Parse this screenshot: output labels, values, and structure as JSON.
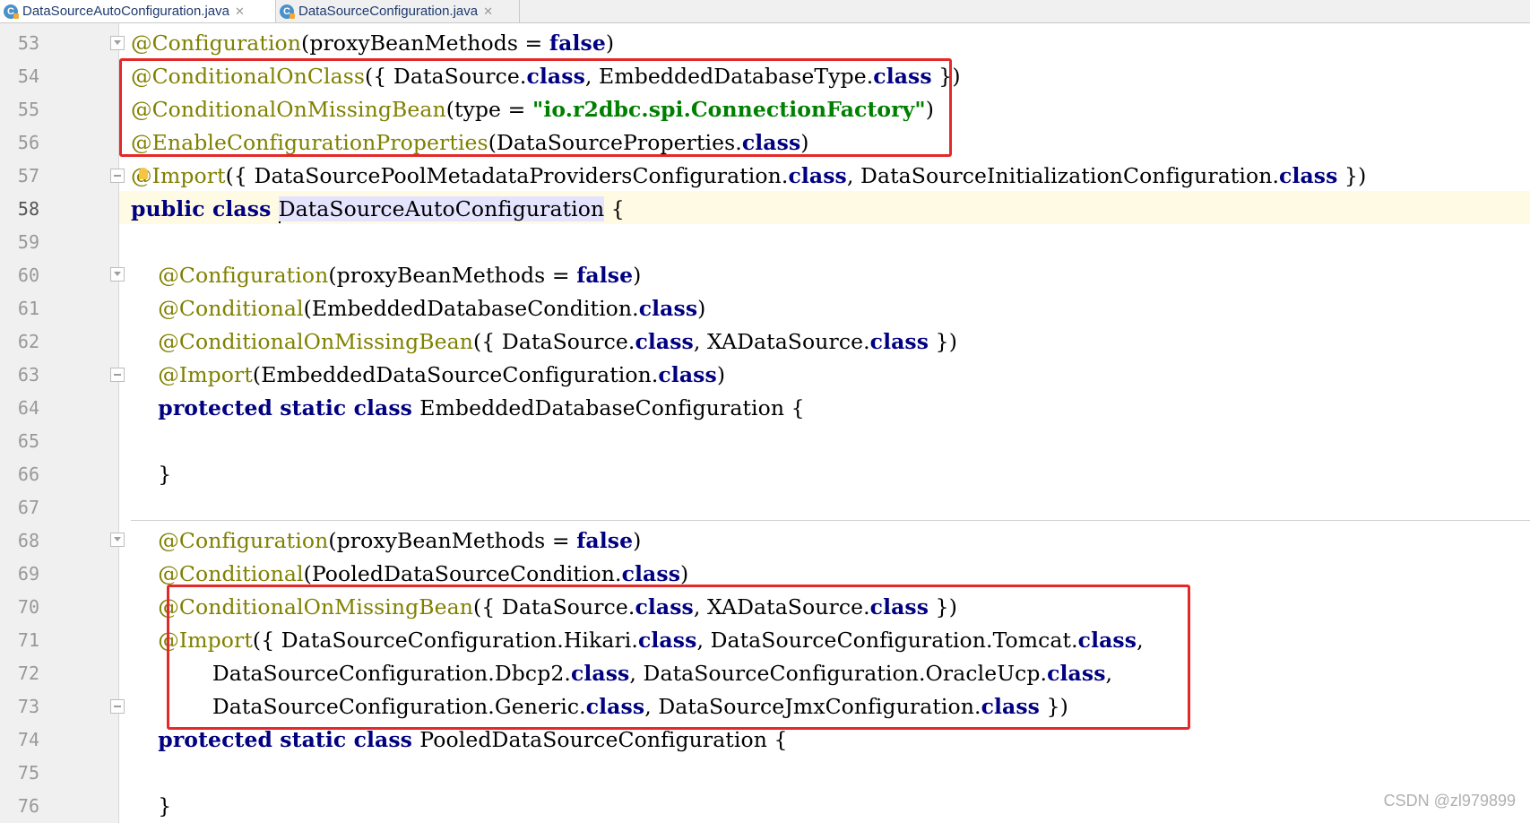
{
  "tabs": [
    {
      "label": "DataSourceAutoConfiguration.java",
      "icon": "java-class-icon",
      "active": true
    },
    {
      "label": "DataSourceConfiguration.java",
      "icon": "java-class-icon",
      "active": false
    }
  ],
  "editor": {
    "caret_line": "58",
    "lines": [
      {
        "num": "53",
        "parts": [
          [
            "ann",
            "@Configuration"
          ],
          [
            "pl",
            "(proxyBeanMethods = "
          ],
          [
            "kw",
            "false"
          ],
          [
            "pl",
            ")"
          ]
        ]
      },
      {
        "num": "54",
        "parts": [
          [
            "ann",
            "@ConditionalOnClass"
          ],
          [
            "pl",
            "({ DataSource."
          ],
          [
            "kw",
            "class"
          ],
          [
            "pl",
            ", EmbeddedDatabaseType."
          ],
          [
            "kw",
            "class"
          ],
          [
            "pl",
            " })"
          ]
        ]
      },
      {
        "num": "55",
        "parts": [
          [
            "ann",
            "@ConditionalOnMissingBean"
          ],
          [
            "pl",
            "(type = "
          ],
          [
            "str",
            "\"io.r2dbc.spi.ConnectionFactory\""
          ],
          [
            "pl",
            ")"
          ]
        ]
      },
      {
        "num": "56",
        "parts": [
          [
            "ann",
            "@EnableConfigurationProperties"
          ],
          [
            "pl",
            "(DataSourceProperties."
          ],
          [
            "kw",
            "class"
          ],
          [
            "pl",
            ")"
          ]
        ]
      },
      {
        "num": "57",
        "parts": [
          [
            "ann",
            "@Import"
          ],
          [
            "pl",
            "({ DataSourcePoolMetadataProvidersConfiguration."
          ],
          [
            "kw",
            "class"
          ],
          [
            "pl",
            ", DataSourceInitializationConfiguration."
          ],
          [
            "kw",
            "class"
          ],
          [
            "pl",
            " })"
          ]
        ]
      },
      {
        "num": "58",
        "parts": [
          [
            "kw",
            "public class "
          ],
          [
            "hl",
            "DataSourceAutoConfiguration"
          ],
          [
            "pl",
            " {"
          ]
        ]
      },
      {
        "num": "59",
        "parts": []
      },
      {
        "num": "60",
        "parts": [
          [
            "pl",
            "    "
          ],
          [
            "ann",
            "@Configuration"
          ],
          [
            "pl",
            "(proxyBeanMethods = "
          ],
          [
            "kw",
            "false"
          ],
          [
            "pl",
            ")"
          ]
        ]
      },
      {
        "num": "61",
        "parts": [
          [
            "pl",
            "    "
          ],
          [
            "ann",
            "@Conditional"
          ],
          [
            "pl",
            "(EmbeddedDatabaseCondition."
          ],
          [
            "kw",
            "class"
          ],
          [
            "pl",
            ")"
          ]
        ]
      },
      {
        "num": "62",
        "parts": [
          [
            "pl",
            "    "
          ],
          [
            "ann",
            "@ConditionalOnMissingBean"
          ],
          [
            "pl",
            "({ DataSource."
          ],
          [
            "kw",
            "class"
          ],
          [
            "pl",
            ", XADataSource."
          ],
          [
            "kw",
            "class"
          ],
          [
            "pl",
            " })"
          ]
        ]
      },
      {
        "num": "63",
        "parts": [
          [
            "pl",
            "    "
          ],
          [
            "ann",
            "@Import"
          ],
          [
            "pl",
            "(EmbeddedDataSourceConfiguration."
          ],
          [
            "kw",
            "class"
          ],
          [
            "pl",
            ")"
          ]
        ]
      },
      {
        "num": "64",
        "parts": [
          [
            "pl",
            "    "
          ],
          [
            "kw",
            "protected static class "
          ],
          [
            "pl",
            "EmbeddedDatabaseConfiguration {"
          ]
        ]
      },
      {
        "num": "65",
        "parts": []
      },
      {
        "num": "66",
        "parts": [
          [
            "pl",
            "    }"
          ]
        ]
      },
      {
        "num": "67",
        "parts": []
      },
      {
        "num": "68",
        "parts": [
          [
            "pl",
            "    "
          ],
          [
            "ann",
            "@Configuration"
          ],
          [
            "pl",
            "(proxyBeanMethods = "
          ],
          [
            "kw",
            "false"
          ],
          [
            "pl",
            ")"
          ]
        ]
      },
      {
        "num": "69",
        "parts": [
          [
            "pl",
            "    "
          ],
          [
            "ann",
            "@Conditional"
          ],
          [
            "pl",
            "(PooledDataSourceCondition."
          ],
          [
            "kw",
            "class"
          ],
          [
            "pl",
            ")"
          ]
        ]
      },
      {
        "num": "70",
        "parts": [
          [
            "pl",
            "    "
          ],
          [
            "ann",
            "@ConditionalOnMissingBean"
          ],
          [
            "pl",
            "({ DataSource."
          ],
          [
            "kw",
            "class"
          ],
          [
            "pl",
            ", XADataSource."
          ],
          [
            "kw",
            "class"
          ],
          [
            "pl",
            " })"
          ]
        ]
      },
      {
        "num": "71",
        "parts": [
          [
            "pl",
            "    "
          ],
          [
            "ann",
            "@Import"
          ],
          [
            "pl",
            "({ DataSourceConfiguration.Hikari."
          ],
          [
            "kw",
            "class"
          ],
          [
            "pl",
            ", DataSourceConfiguration.Tomcat."
          ],
          [
            "kw",
            "class"
          ],
          [
            "pl",
            ","
          ]
        ]
      },
      {
        "num": "72",
        "parts": [
          [
            "pl",
            "            DataSourceConfiguration.Dbcp2."
          ],
          [
            "kw",
            "class"
          ],
          [
            "pl",
            ", DataSourceConfiguration.OracleUcp."
          ],
          [
            "kw",
            "class"
          ],
          [
            "pl",
            ","
          ]
        ]
      },
      {
        "num": "73",
        "parts": [
          [
            "pl",
            "            DataSourceConfiguration.Generic."
          ],
          [
            "kw",
            "class"
          ],
          [
            "pl",
            ", DataSourceJmxConfiguration."
          ],
          [
            "kw",
            "class"
          ],
          [
            "pl",
            " })"
          ]
        ]
      },
      {
        "num": "74",
        "parts": [
          [
            "pl",
            "    "
          ],
          [
            "kw",
            "protected static class "
          ],
          [
            "pl",
            "PooledDataSourceConfiguration {"
          ]
        ]
      },
      {
        "num": "75",
        "parts": []
      },
      {
        "num": "76",
        "parts": [
          [
            "pl",
            "    }"
          ]
        ]
      }
    ]
  },
  "watermark": "CSDN @zl979899"
}
